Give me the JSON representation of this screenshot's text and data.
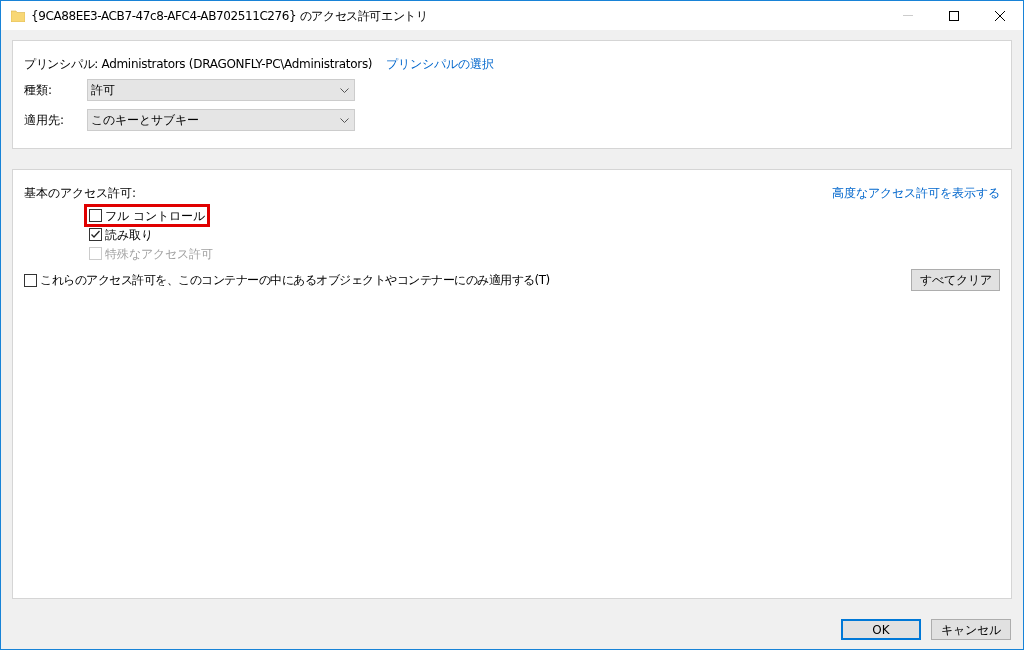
{
  "window": {
    "title": "{9CA88EE3-ACB7-47c8-AFC4-AB702511C276} のアクセス許可エントリ"
  },
  "principal": {
    "label": "プリンシパル:",
    "value": "Administrators (DRAGONFLY-PC\\Administrators)",
    "link": "プリンシパルの選択"
  },
  "fields": [
    {
      "label": "種類:",
      "value": "許可"
    },
    {
      "label": "適用先:",
      "value": "このキーとサブキー"
    }
  ],
  "permissions": {
    "heading": "基本のアクセス許可:",
    "advanced_link": "高度なアクセス許可を表示する",
    "items": [
      {
        "label": "フル コントロール",
        "checked": false,
        "disabled": false,
        "highlighted": true
      },
      {
        "label": "読み取り",
        "checked": true,
        "disabled": false,
        "highlighted": false
      },
      {
        "label": "特殊なアクセス許可",
        "checked": false,
        "disabled": true,
        "highlighted": false
      }
    ],
    "apply_only": {
      "label": "これらのアクセス許可を、このコンテナーの中にあるオブジェクトやコンテナーにのみ適用する(T)",
      "checked": false
    },
    "clear_button": "すべてクリア"
  },
  "buttons": [
    {
      "label": "OK",
      "default": true
    },
    {
      "label": "キャンセル",
      "default": false
    }
  ]
}
